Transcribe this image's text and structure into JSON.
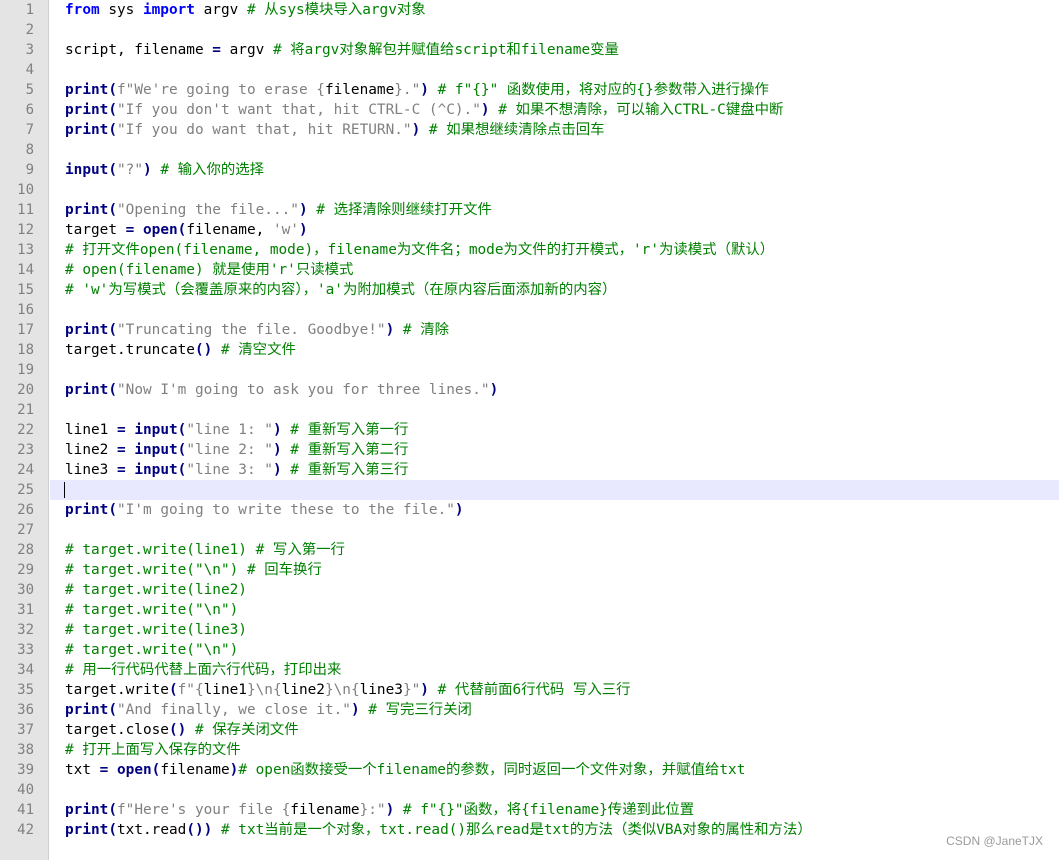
{
  "editor": {
    "current_line": 25,
    "lines": [
      {
        "n": "1",
        "tokens": [
          [
            "kw",
            "from"
          ],
          [
            "id",
            " sys "
          ],
          [
            "kw",
            "import"
          ],
          [
            "id",
            " argv "
          ],
          [
            "cm",
            "# 从sys模块导入argv对象"
          ]
        ]
      },
      {
        "n": "2",
        "tokens": []
      },
      {
        "n": "3",
        "tokens": [
          [
            "id",
            "script, filename "
          ],
          [
            "op",
            "="
          ],
          [
            "id",
            " argv "
          ],
          [
            "cm",
            "# 将argv对象解包并赋值给script和filename变量"
          ]
        ]
      },
      {
        "n": "4",
        "tokens": []
      },
      {
        "n": "5",
        "tokens": [
          [
            "bi",
            "print"
          ],
          [
            "op",
            "("
          ],
          [
            "st",
            "f\"We're going to erase {"
          ],
          [
            "id",
            "filename"
          ],
          [
            "st",
            "}.\""
          ],
          [
            "op",
            ")"
          ],
          [
            "cm",
            " # f\"{}\" 函数使用，将对应的{}参数带入进行操作"
          ]
        ]
      },
      {
        "n": "6",
        "tokens": [
          [
            "bi",
            "print"
          ],
          [
            "op",
            "("
          ],
          [
            "st",
            "\"If you don't want that, hit CTRL-C (^C).\""
          ],
          [
            "op",
            ")"
          ],
          [
            "cm",
            " # 如果不想清除，可以输入CTRL-C键盘中断"
          ]
        ]
      },
      {
        "n": "7",
        "tokens": [
          [
            "bi",
            "print"
          ],
          [
            "op",
            "("
          ],
          [
            "st",
            "\"If you do want that, hit RETURN.\""
          ],
          [
            "op",
            ")"
          ],
          [
            "cm",
            " # 如果想继续清除点击回车"
          ]
        ]
      },
      {
        "n": "8",
        "tokens": []
      },
      {
        "n": "9",
        "tokens": [
          [
            "bi",
            "input"
          ],
          [
            "op",
            "("
          ],
          [
            "st",
            "\"?\""
          ],
          [
            "op",
            ")"
          ],
          [
            "cm",
            " # 输入你的选择"
          ]
        ]
      },
      {
        "n": "10",
        "tokens": []
      },
      {
        "n": "11",
        "tokens": [
          [
            "bi",
            "print"
          ],
          [
            "op",
            "("
          ],
          [
            "st",
            "\"Opening the file...\""
          ],
          [
            "op",
            ")"
          ],
          [
            "cm",
            " # 选择清除则继续打开文件"
          ]
        ]
      },
      {
        "n": "12",
        "tokens": [
          [
            "id",
            "target "
          ],
          [
            "op",
            "="
          ],
          [
            "id",
            " "
          ],
          [
            "bi",
            "open"
          ],
          [
            "op",
            "("
          ],
          [
            "id",
            "filename, "
          ],
          [
            "st",
            "'w'"
          ],
          [
            "op",
            ")"
          ]
        ]
      },
      {
        "n": "13",
        "tokens": [
          [
            "cm",
            "# 打开文件open(filename, mode)，filename为文件名；mode为文件的打开模式，'r'为读模式（默认）"
          ]
        ]
      },
      {
        "n": "14",
        "tokens": [
          [
            "cm",
            "# open(filename) 就是使用'r'只读模式"
          ]
        ]
      },
      {
        "n": "15",
        "tokens": [
          [
            "cm",
            "# 'w'为写模式（会覆盖原来的内容），'a'为附加模式（在原内容后面添加新的内容）"
          ]
        ]
      },
      {
        "n": "16",
        "tokens": []
      },
      {
        "n": "17",
        "tokens": [
          [
            "bi",
            "print"
          ],
          [
            "op",
            "("
          ],
          [
            "st",
            "\"Truncating the file. Goodbye!\""
          ],
          [
            "op",
            ")"
          ],
          [
            "cm",
            " # 清除"
          ]
        ]
      },
      {
        "n": "18",
        "tokens": [
          [
            "id",
            "target.truncate"
          ],
          [
            "op",
            "()"
          ],
          [
            "cm",
            " # 清空文件"
          ]
        ]
      },
      {
        "n": "19",
        "tokens": []
      },
      {
        "n": "20",
        "tokens": [
          [
            "bi",
            "print"
          ],
          [
            "op",
            "("
          ],
          [
            "st",
            "\"Now I'm going to ask you for three lines.\""
          ],
          [
            "op",
            ")"
          ]
        ]
      },
      {
        "n": "21",
        "tokens": []
      },
      {
        "n": "22",
        "tokens": [
          [
            "id",
            "line1 "
          ],
          [
            "op",
            "="
          ],
          [
            "id",
            " "
          ],
          [
            "bi",
            "input"
          ],
          [
            "op",
            "("
          ],
          [
            "st",
            "\"line 1: \""
          ],
          [
            "op",
            ")"
          ],
          [
            "cm",
            " # 重新写入第一行"
          ]
        ]
      },
      {
        "n": "23",
        "tokens": [
          [
            "id",
            "line2 "
          ],
          [
            "op",
            "="
          ],
          [
            "id",
            " "
          ],
          [
            "bi",
            "input"
          ],
          [
            "op",
            "("
          ],
          [
            "st",
            "\"line 2: \""
          ],
          [
            "op",
            ")"
          ],
          [
            "cm",
            " # 重新写入第二行"
          ]
        ]
      },
      {
        "n": "24",
        "tokens": [
          [
            "id",
            "line3 "
          ],
          [
            "op",
            "="
          ],
          [
            "id",
            " "
          ],
          [
            "bi",
            "input"
          ],
          [
            "op",
            "("
          ],
          [
            "st",
            "\"line 3: \""
          ],
          [
            "op",
            ")"
          ],
          [
            "cm",
            " # 重新写入第三行"
          ]
        ]
      },
      {
        "n": "25",
        "tokens": []
      },
      {
        "n": "26",
        "tokens": [
          [
            "bi",
            "print"
          ],
          [
            "op",
            "("
          ],
          [
            "st",
            "\"I'm going to write these to the file.\""
          ],
          [
            "op",
            ")"
          ]
        ]
      },
      {
        "n": "27",
        "tokens": []
      },
      {
        "n": "28",
        "tokens": [
          [
            "cm",
            "# target.write(line1) # 写入第一行"
          ]
        ]
      },
      {
        "n": "29",
        "tokens": [
          [
            "cm",
            "# target.write(\"\\n\") # 回车换行"
          ]
        ]
      },
      {
        "n": "30",
        "tokens": [
          [
            "cm",
            "# target.write(line2)"
          ]
        ]
      },
      {
        "n": "31",
        "tokens": [
          [
            "cm",
            "# target.write(\"\\n\")"
          ]
        ]
      },
      {
        "n": "32",
        "tokens": [
          [
            "cm",
            "# target.write(line3)"
          ]
        ]
      },
      {
        "n": "33",
        "tokens": [
          [
            "cm",
            "# target.write(\"\\n\")"
          ]
        ]
      },
      {
        "n": "34",
        "tokens": [
          [
            "cm",
            "# 用一行代码代替上面六行代码，打印出来"
          ]
        ]
      },
      {
        "n": "35",
        "tokens": [
          [
            "id",
            "target.write"
          ],
          [
            "op",
            "("
          ],
          [
            "st",
            "f\"{"
          ],
          [
            "id",
            "line1"
          ],
          [
            "st",
            "}\\n{"
          ],
          [
            "id",
            "line2"
          ],
          [
            "st",
            "}\\n{"
          ],
          [
            "id",
            "line3"
          ],
          [
            "st",
            "}\""
          ],
          [
            "op",
            ")"
          ],
          [
            "cm",
            " # 代替前面6行代码 写入三行"
          ]
        ]
      },
      {
        "n": "36",
        "tokens": [
          [
            "bi",
            "print"
          ],
          [
            "op",
            "("
          ],
          [
            "st",
            "\"And finally, we close it.\""
          ],
          [
            "op",
            ")"
          ],
          [
            "cm",
            " # 写完三行关闭"
          ]
        ]
      },
      {
        "n": "37",
        "tokens": [
          [
            "id",
            "target.close"
          ],
          [
            "op",
            "()"
          ],
          [
            "cm",
            " # 保存关闭文件"
          ]
        ]
      },
      {
        "n": "38",
        "tokens": [
          [
            "cm",
            "# 打开上面写入保存的文件"
          ]
        ]
      },
      {
        "n": "39",
        "tokens": [
          [
            "id",
            "txt "
          ],
          [
            "op",
            "="
          ],
          [
            "id",
            " "
          ],
          [
            "bi",
            "open"
          ],
          [
            "op",
            "("
          ],
          [
            "id",
            "filename"
          ],
          [
            "op",
            ")"
          ],
          [
            "cm",
            "# open函数接受一个filename的参数，同时返回一个文件对象，并赋值给txt"
          ]
        ]
      },
      {
        "n": "40",
        "tokens": []
      },
      {
        "n": "41",
        "tokens": [
          [
            "bi",
            "print"
          ],
          [
            "op",
            "("
          ],
          [
            "st",
            "f\"Here's your file {"
          ],
          [
            "id",
            "filename"
          ],
          [
            "st",
            "}:\""
          ],
          [
            "op",
            ")"
          ],
          [
            "cm",
            " # f\"{}\"函数，将{filename}传递到此位置"
          ]
        ]
      },
      {
        "n": "42",
        "tokens": [
          [
            "bi",
            "print"
          ],
          [
            "op",
            "("
          ],
          [
            "id",
            "txt.read"
          ],
          [
            "op",
            "())"
          ],
          [
            "cm",
            " # txt当前是一个对象，txt.read()那么read是txt的方法（类似VBA对象的属性和方法）"
          ]
        ]
      }
    ]
  },
  "watermark": "CSDN @JaneTJX",
  "colors": {
    "keyword": "#0000ff",
    "builtin": "#000080",
    "string": "#808080",
    "comment": "#008000",
    "gutter_bg": "#e4e4e4",
    "current_line_bg": "#e8e8ff"
  }
}
